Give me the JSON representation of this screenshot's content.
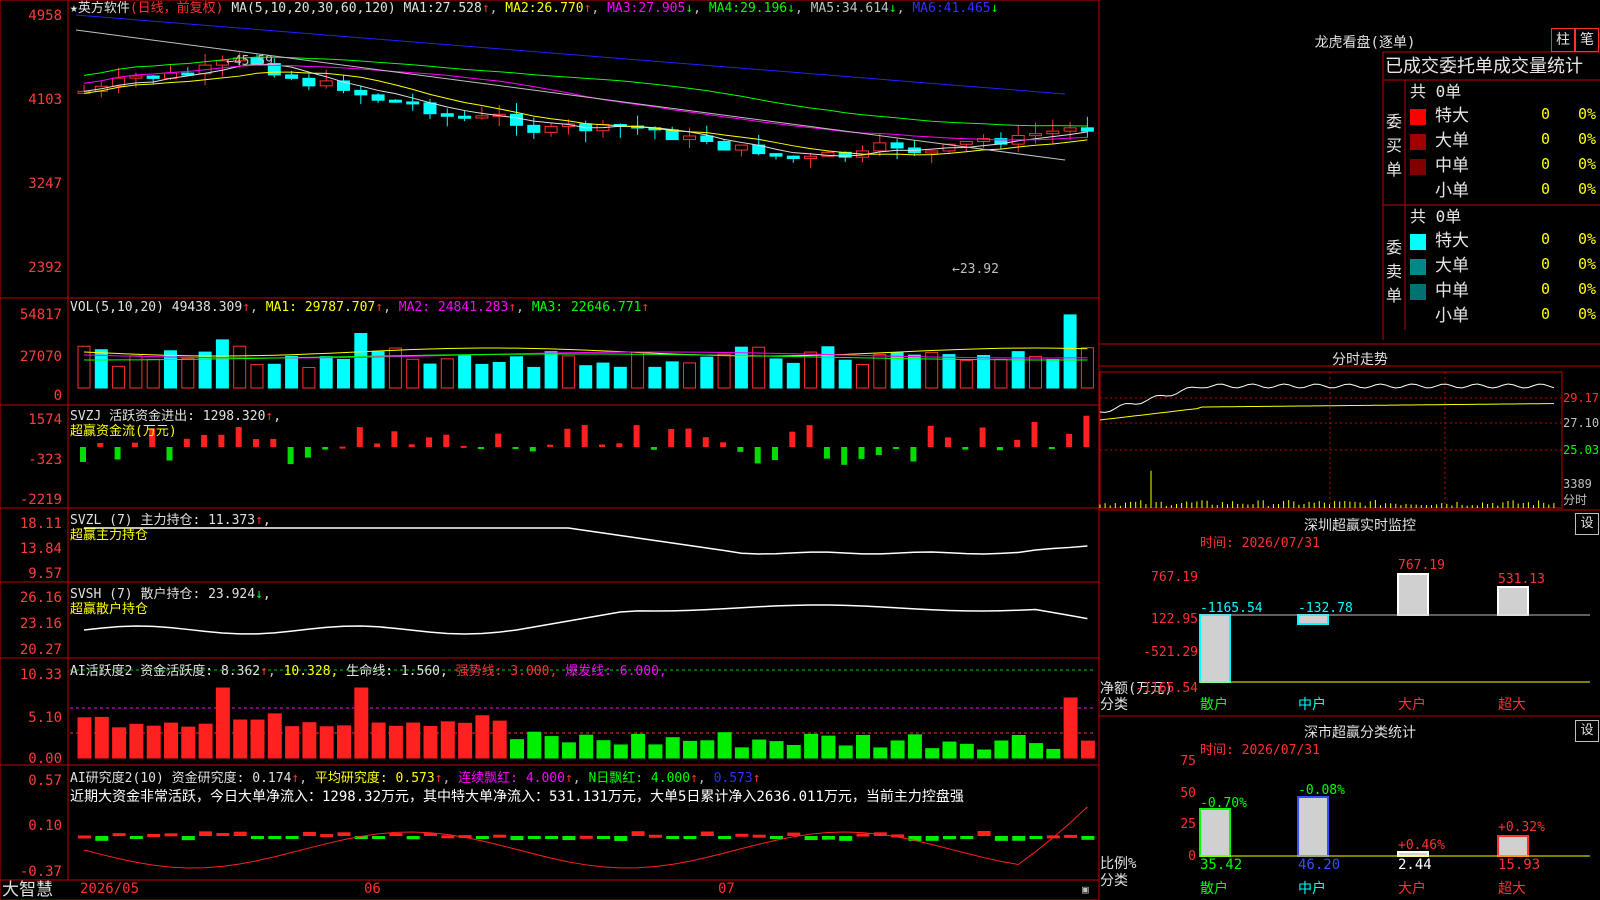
{
  "stock": {
    "star": "★",
    "name": "英方软件",
    "mode": "(日线，前复权)",
    "ma_header": "MA(5,10,20,30,60,120)",
    "ma": [
      {
        "label": "MA1:",
        "value": "27.528",
        "arrow": "↑",
        "color": "#e0e0e0"
      },
      {
        "label": "MA2:",
        "value": "26.770",
        "arrow": "↑",
        "color": "#ffff00"
      },
      {
        "label": "MA3:",
        "value": "27.905",
        "arrow": "↓",
        "color": "#ff00ff"
      },
      {
        "label": "MA4:",
        "value": "29.196",
        "arrow": "↓",
        "color": "#00ff00"
      },
      {
        "label": "MA5:",
        "value": "34.614",
        "arrow": "↓",
        "color": "#c0c0c0"
      },
      {
        "label": "MA6:",
        "value": "41.465",
        "arrow": "↓",
        "color": "#3030ff"
      }
    ],
    "price_axis": [
      "4958",
      "4103",
      "3247",
      "2392"
    ],
    "high_note": "←45.59",
    "low_note": "←23.92"
  },
  "vol": {
    "header": "VOL(5,10,20)",
    "value": "49438.309",
    "ma1": "MA1: 29787.707",
    "ma2": "MA2: 24841.283",
    "ma3": "MA3: 22646.771",
    "axis": [
      "54817",
      "27070",
      "0"
    ]
  },
  "svzj": {
    "header": "SVZJ  活跃资金进出: 1298.320",
    "sub": "超赢资金流(万元)",
    "axis": [
      "1574",
      "-323",
      "-2219"
    ]
  },
  "svzl": {
    "header": "SVZL (7) 主力持仓: 11.373",
    "sub": "超赢主力持仓",
    "axis": [
      "18.11",
      "13.84",
      "9.57"
    ]
  },
  "svsh": {
    "header": "SVSH (7) 散户持仓: 23.924",
    "sub": "超赢散户持仓",
    "axis": [
      "26.16",
      "23.16",
      "20.27"
    ]
  },
  "ai1": {
    "a": "AI活跃度2 资金活跃度: 8.362",
    "b": "10.328,",
    "c": "生命线: 1.560,",
    "d": "强势线: 3.000,",
    "e": "爆发线: 6.000,",
    "axis": [
      "10.33",
      "5.10",
      "0.00"
    ]
  },
  "ai2": {
    "a": "AI研究度2(10) 资金研究度: 0.174",
    "b": "平均研究度: 0.573",
    "c": "连续飘红: 4.000",
    "d": "N日飘红: 4.000",
    "e": "0.573",
    "note": "近期大资金非常活跃，今日大单净流入：1298.32万元，其中特大单净流入：531.131万元，大单5日累计净入2636.011万元，当前主力控盘强",
    "axis": [
      "0.57",
      "0.10",
      "-0.37"
    ]
  },
  "bottom": {
    "brand": "大智慧",
    "dates": [
      "2026/05",
      "06",
      "07"
    ]
  },
  "right": {
    "lhb_title": "龙虎看盘(逐单)",
    "btn_zhu": "柱",
    "btn_bi": "笔",
    "table_title": "已成交委托单成交量统计",
    "buy_label": "委买单",
    "sell_label": "委卖单",
    "buy_total": "共 0单",
    "sell_total": "共 0单",
    "buy_rows": [
      {
        "name": "特大",
        "count": "0",
        "pct": "0%",
        "color": "#ff0000"
      },
      {
        "name": "大单",
        "count": "0",
        "pct": "0%",
        "color": "#a00000"
      },
      {
        "name": "中单",
        "count": "0",
        "pct": "0%",
        "color": "#800000"
      },
      {
        "name": "小单",
        "count": "0",
        "pct": "0%",
        "color": "#000000"
      }
    ],
    "sell_rows": [
      {
        "name": "特大",
        "count": "0",
        "pct": "0%",
        "color": "#00ffff"
      },
      {
        "name": "大单",
        "count": "0",
        "pct": "0%",
        "color": "#008888"
      },
      {
        "name": "中单",
        "count": "0",
        "pct": "0%",
        "color": "#007070"
      },
      {
        "name": "小单",
        "count": "0",
        "pct": "0%",
        "color": "#000000"
      }
    ],
    "fs_title": "分时走势",
    "fs_axis": [
      "29.17",
      "27.10",
      "25.03",
      "3389",
      "分时"
    ],
    "mon_title": "深圳超赢实时监控",
    "mon_set": "设",
    "mon_time": "时间: 2026/07/31",
    "mon_axis": [
      "767.19",
      "122.95",
      "-521.29",
      "-1165.54"
    ],
    "mon_ylabel": "净额(万元)",
    "mon_xlabel": "分类",
    "mon_cats": [
      "散户",
      "中户",
      "大户",
      "超大"
    ],
    "mon_values": [
      "-1165.54",
      "-132.78",
      "767.19",
      "531.13"
    ],
    "cls_title": "深市超赢分类统计",
    "cls_set": "设",
    "cls_time": "时间: 2026/07/31",
    "cls_axis": [
      "75",
      "50",
      "25",
      "0"
    ],
    "cls_ylabel": "比例%",
    "cls_xlabel": "分类",
    "cls_cats": [
      "散户",
      "中户",
      "大户",
      "超大"
    ],
    "cls_top": [
      "-0.70%",
      "-0.08%",
      "+0.46%",
      "+0.32%"
    ],
    "cls_bottom": [
      "35.42",
      "46.20",
      "2.44",
      "15.93"
    ]
  }
}
